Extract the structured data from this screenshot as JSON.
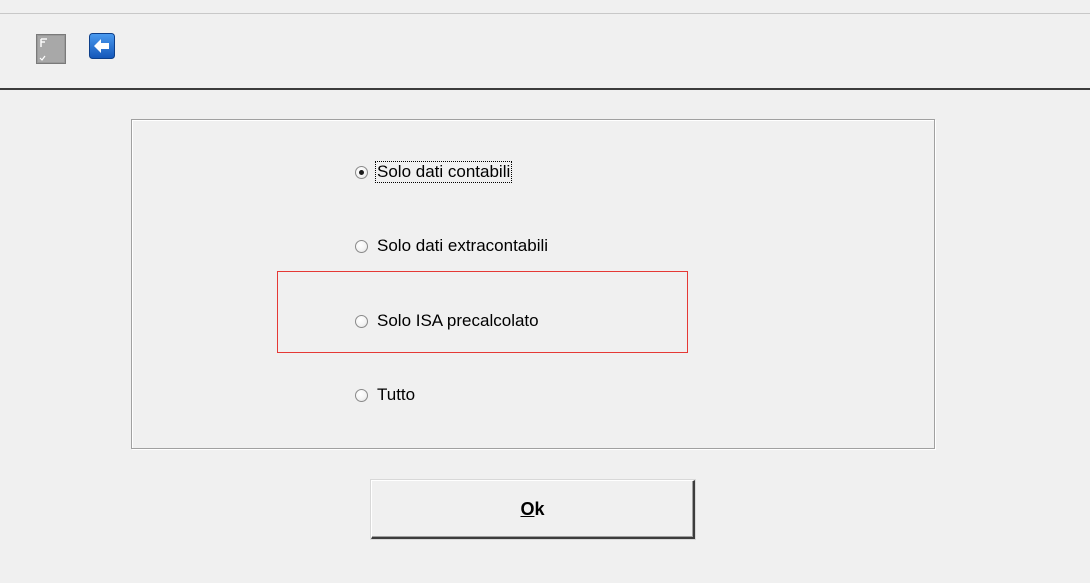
{
  "toolbar": {
    "document_icon": "document-icon",
    "back_icon": "back-arrow-icon"
  },
  "options": {
    "items": [
      {
        "label": "Solo dati contabili",
        "checked": true,
        "focused": true
      },
      {
        "label": "Solo dati extracontabili",
        "checked": false
      },
      {
        "label": "Solo ISA precalcolato",
        "checked": false
      },
      {
        "label": "Tutto",
        "checked": false
      }
    ]
  },
  "highlight": {
    "target": "Solo ISA precalcolato",
    "color": "#e53935"
  },
  "ok_button": {
    "accelerator": "O",
    "rest": "k"
  },
  "colors": {
    "background": "#f0f0f0",
    "toolbar_separator": "#3c3c3c",
    "back_icon": "#1e6fd9"
  }
}
